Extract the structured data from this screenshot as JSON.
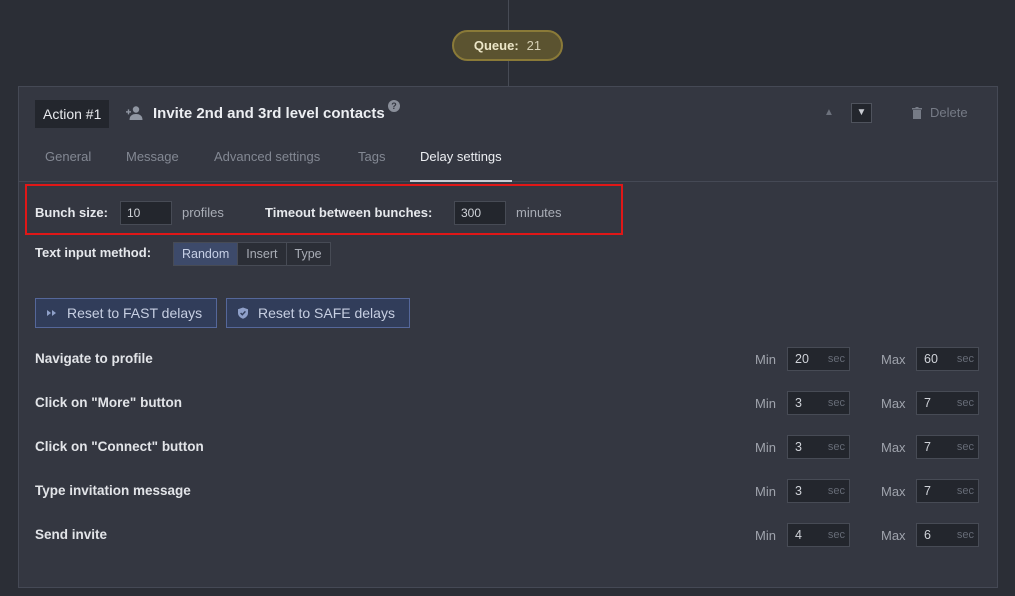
{
  "queue": {
    "label": "Queue:",
    "count": "21"
  },
  "action": {
    "number_label": "Action #1",
    "title": "Invite 2nd and 3rd level contacts",
    "help_glyph": "?",
    "delete_label": "Delete"
  },
  "tabs": [
    {
      "label": "General"
    },
    {
      "label": "Message"
    },
    {
      "label": "Advanced settings"
    },
    {
      "label": "Tags"
    },
    {
      "label": "Delay settings",
      "active": true
    }
  ],
  "bunch": {
    "size_label": "Bunch size:",
    "size_value": "10",
    "size_unit": "profiles",
    "timeout_label": "Timeout between bunches:",
    "timeout_value": "300",
    "timeout_unit": "minutes"
  },
  "text_input": {
    "label": "Text input method:",
    "options": [
      "Random",
      "Insert",
      "Type"
    ],
    "selected": "Random"
  },
  "reset_buttons": {
    "fast_label": "Reset to FAST delays",
    "safe_label": "Reset to SAFE delays"
  },
  "delays": {
    "min_label": "Min",
    "max_label": "Max",
    "unit": "sec",
    "rows": [
      {
        "label": "Navigate to profile",
        "min": "20",
        "max": "60"
      },
      {
        "label": "Click on \"More\" button",
        "min": "3",
        "max": "7"
      },
      {
        "label": "Click on \"Connect\" button",
        "min": "3",
        "max": "7"
      },
      {
        "label": "Type invitation message",
        "min": "3",
        "max": "7"
      },
      {
        "label": "Send invite",
        "min": "4",
        "max": "6"
      }
    ]
  },
  "colors": {
    "background": "#2b2e36",
    "panel": "#343741",
    "highlight_box": "#e01717",
    "queue_border": "#8a7a38",
    "button_accent": "#55679a"
  }
}
